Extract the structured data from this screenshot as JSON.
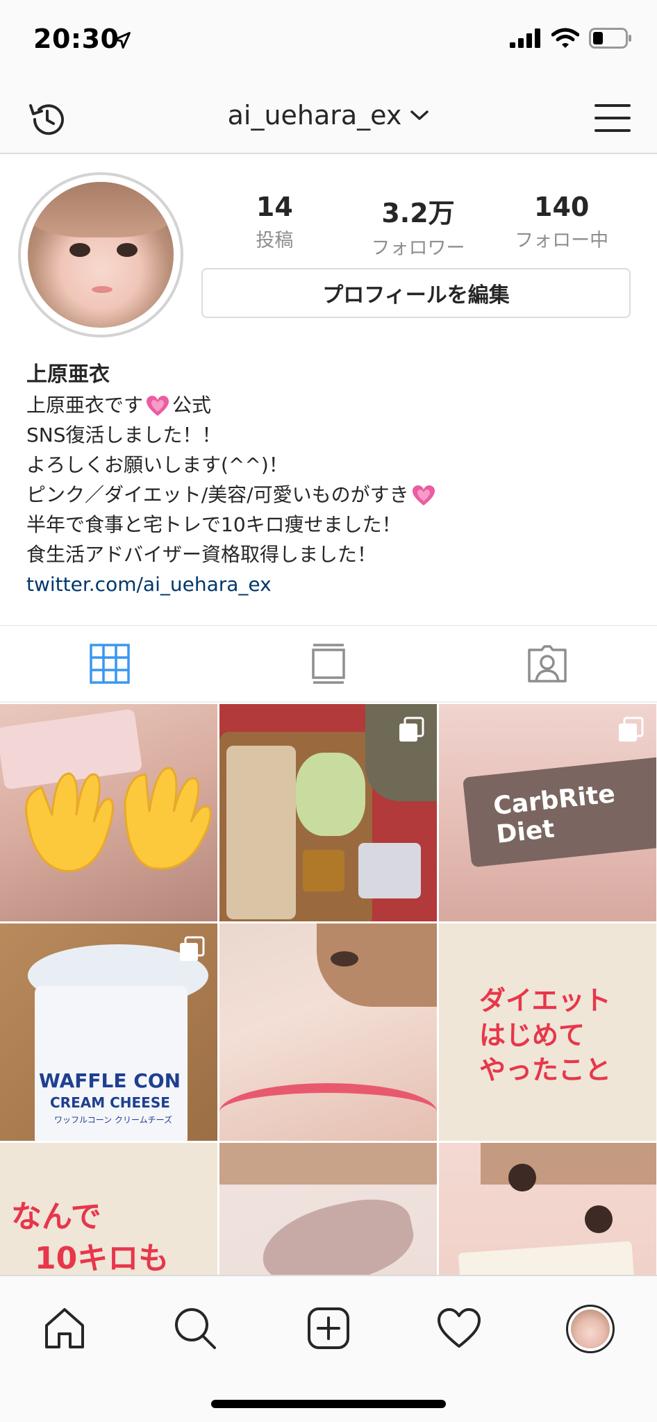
{
  "status_bar": {
    "time": "20:30"
  },
  "header": {
    "username": "ai_uehara_ex"
  },
  "profile": {
    "stats": [
      {
        "value": "14",
        "label": "投稿"
      },
      {
        "value": "3.2万",
        "label": "フォロワー"
      },
      {
        "value": "140",
        "label": "フォロー中"
      }
    ],
    "edit_button": "プロフィールを編集",
    "name": "上原亜衣",
    "bio_lines": {
      "l1a": "上原亜衣です",
      "l1b": "公式",
      "l2": "SNS復活しました！！",
      "l3": "よろしくお願いします(^^)！",
      "l4": "ピンク／ダイエット/美容/可愛いものがすき",
      "l5": "半年で食事と宅トレで10キロ痩せました！",
      "l6": "食生活アドバイザー資格取得しました！"
    },
    "link": "twitter.com/ai_uehara_ex"
  },
  "tabs": [
    {
      "icon": "grid-icon",
      "active": true
    },
    {
      "icon": "feed-icon",
      "active": false
    },
    {
      "icon": "tagged-icon",
      "active": false
    }
  ],
  "posts": {
    "p3_wrapper": "CarbRite Diet",
    "p4_cup_main": "WAFFLE CON",
    "p4_cup_sub": "CREAM CHEESE",
    "p4_cup_jp": "ワッフルコーン クリームチーズ",
    "p6_line1": "ダイエット",
    "p6_line2": "はじめて",
    "p6_line3": "やったこと",
    "p7_line1": "なんで",
    "p7_line2": "10キロも"
  },
  "bottom_nav": [
    "home-icon",
    "search-icon",
    "new-post-icon",
    "activity-icon",
    "profile-avatar"
  ],
  "colors": {
    "accent": "#3897f0",
    "link": "#00376b",
    "muted": "#8e8e8e",
    "pink_text": "#e8364a"
  }
}
